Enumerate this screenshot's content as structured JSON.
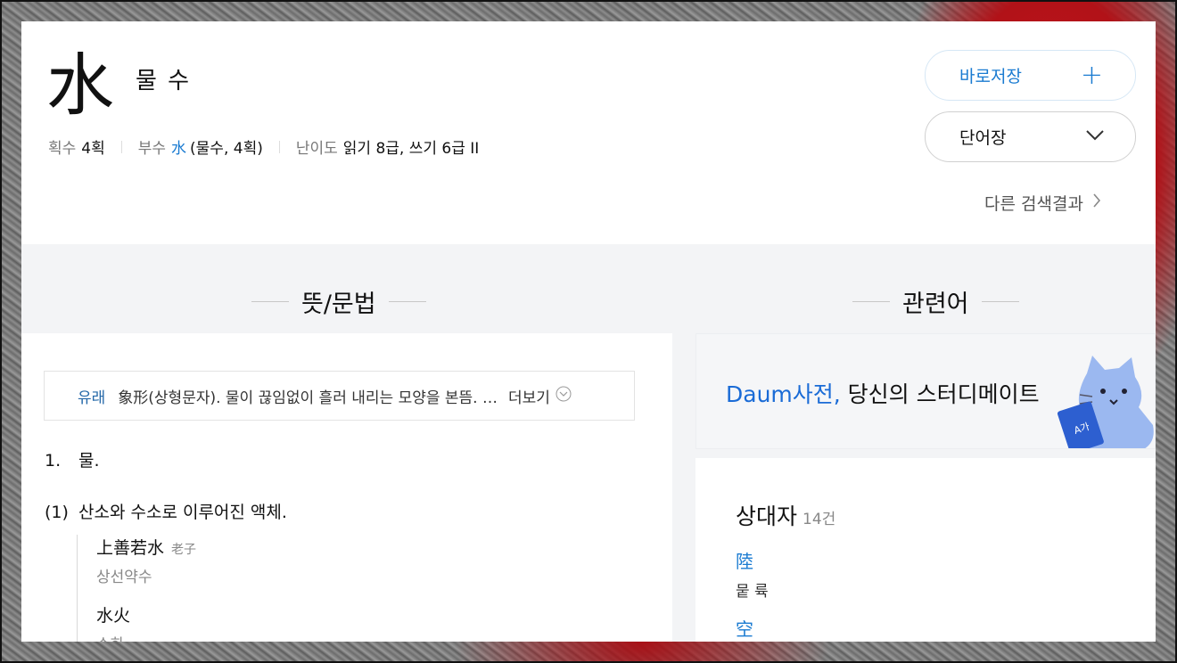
{
  "entry": {
    "hanja": "水",
    "reading": "물 수",
    "meta": {
      "strokes_label": "획수",
      "strokes_value": "4획",
      "radical_label": "부수",
      "radical_char": "水",
      "radical_desc": "(물수, 4획)",
      "level_label": "난이도",
      "level_value": "읽기 8급, 쓰기 6급 II"
    }
  },
  "actions": {
    "save_label": "바로저장",
    "save_icon": "+",
    "vocab_label": "단어장",
    "other_results_label": "다른 검색결과"
  },
  "sections": {
    "meaning_title": "뜻/문법",
    "related_title": "관련어"
  },
  "origin": {
    "label": "유래",
    "text": "象形(상형문자). 물이 끊임없이 흘러 내리는 모양을 본뜸. …",
    "more_label": "더보기"
  },
  "definitions": [
    {
      "num": "1.",
      "text": "물."
    },
    {
      "num": "(1)",
      "text": "산소와 수소로 이루어진 액체."
    }
  ],
  "examples": [
    {
      "hanja": "上善若水",
      "source": "老子",
      "reading": "상선약수"
    },
    {
      "hanja": "水火",
      "source": "",
      "reading": "수화"
    }
  ],
  "promo": {
    "brand": "Daum사전,",
    "text": "당신의 스터디메이트"
  },
  "related": {
    "heading": "상대자",
    "count": "14건",
    "items": [
      {
        "char": "陸",
        "reading": "뭍 륙"
      },
      {
        "char": "空",
        "reading": ""
      }
    ]
  },
  "colors": {
    "accent": "#1a7bd1",
    "brand": "#1a6bd6",
    "band_bg": "#f3f4f6"
  },
  "icons": [
    "plus-icon",
    "chevron-down-icon",
    "chevron-right-icon",
    "chevron-circle-down-icon",
    "cat-mascot-icon"
  ]
}
